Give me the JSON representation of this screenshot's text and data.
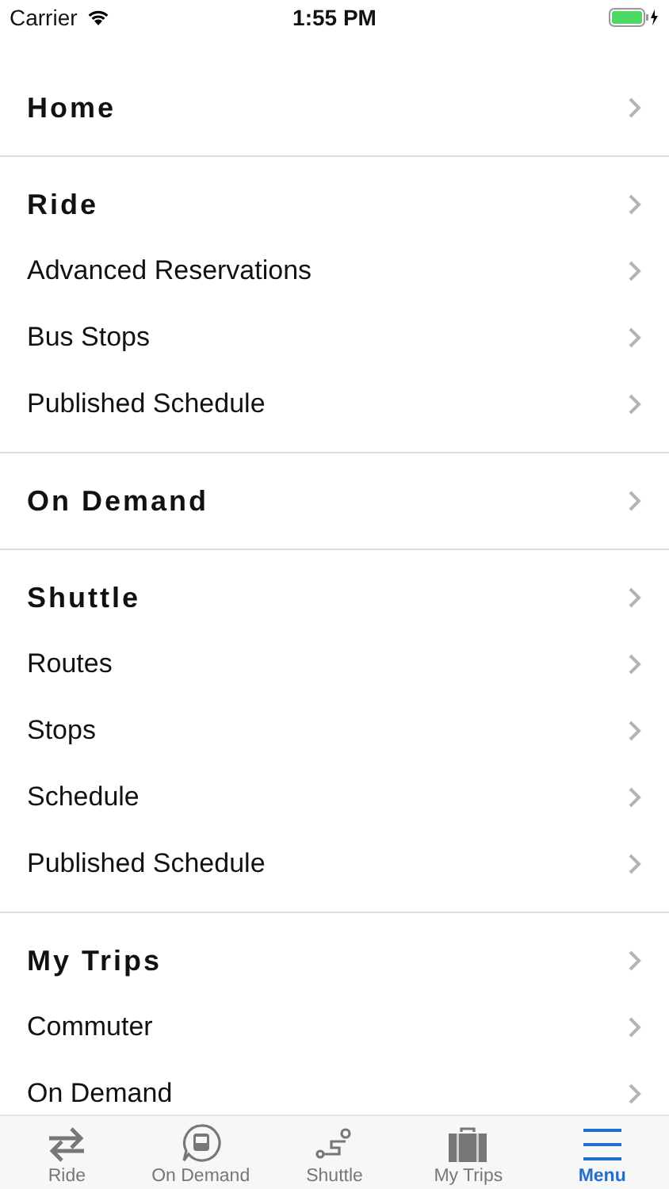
{
  "status_bar": {
    "carrier": "Carrier",
    "time": "1:55 PM"
  },
  "sections": [
    {
      "title": "Home"
    },
    {
      "title": "Ride",
      "items": [
        "Advanced Reservations",
        "Bus Stops",
        "Published Schedule"
      ]
    },
    {
      "title": "On Demand"
    },
    {
      "title": "Shuttle",
      "items": [
        "Routes",
        "Stops",
        "Schedule",
        "Published Schedule"
      ]
    },
    {
      "title": "My Trips",
      "items": [
        "Commuter",
        "On Demand"
      ]
    }
  ],
  "tab_bar": [
    {
      "kind": "arrows",
      "label": "Ride",
      "selected": false
    },
    {
      "kind": "bus",
      "label": "On Demand",
      "selected": false
    },
    {
      "kind": "route",
      "label": "Shuttle",
      "selected": false
    },
    {
      "kind": "suitcase",
      "label": "My Trips",
      "selected": false
    },
    {
      "kind": "menu",
      "label": "Menu",
      "selected": true
    }
  ]
}
